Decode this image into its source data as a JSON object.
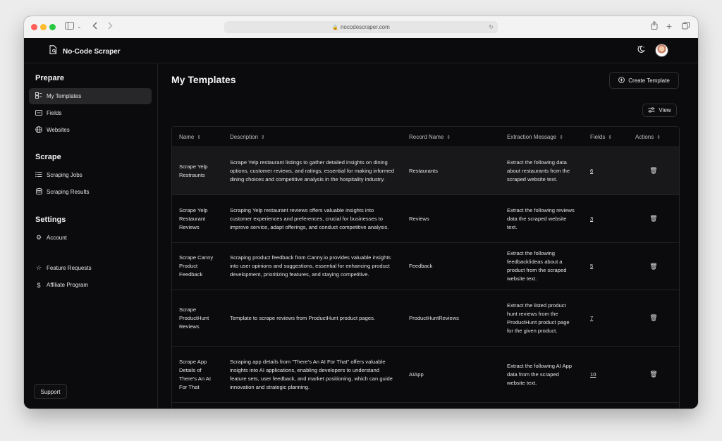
{
  "browser": {
    "url": "nocodescraper.com"
  },
  "app": {
    "name": "No-Code Scraper"
  },
  "sidebar": {
    "sections": [
      {
        "title": "Prepare",
        "items": [
          "My Templates",
          "Fields",
          "Websites"
        ]
      },
      {
        "title": "Scrape",
        "items": [
          "Scraping Jobs",
          "Scraping Results"
        ]
      },
      {
        "title": "Settings",
        "items": [
          "Account"
        ]
      }
    ],
    "extra_items": [
      "Feature Requests",
      "Affiliate Program"
    ],
    "support_label": "Support"
  },
  "main": {
    "title": "My Templates",
    "create_label": "Create Template",
    "view_label": "View"
  },
  "table": {
    "headers": [
      "Name",
      "Description",
      "Record Name",
      "Extraction Message",
      "Fields",
      "Actions"
    ],
    "rows": [
      {
        "name": "Scrape Yelp Restraunts",
        "description": "Scrape Yelp restaurant listings to gather detailed insights on dining options, customer reviews, and ratings, essential for making informed dining choices and competitive analysis in the hospitality industry.",
        "record": "Restaurants",
        "message": "Extract the following data about restaurants from the scraped website text.",
        "fields": "6"
      },
      {
        "name": "Scrape Yelp Restaurant Reviews",
        "description": "Scraping Yelp restaurant reviews offers valuable insights into customer experiences and preferences, crucial for businesses to improve service, adapt offerings, and conduct competitive analysis.",
        "record": "Reviews",
        "message": "Extract the following reviews data the scraped website text.",
        "fields": "3"
      },
      {
        "name": "Scrape Canny Product Feedback",
        "description": "Scraping product feedback from Canny.io provides valuable insights into user opinions and suggestions, essential for enhancing product development, prioritizing features, and staying competitive.",
        "record": "Feedback",
        "message": "Extract the following feedback/ideas about a product from the scraped website text.",
        "fields": "5"
      },
      {
        "name": "Scrape ProductHunt Reviews",
        "description": "Template to scrape reviews from ProductHunt product pages.",
        "record": "ProductHuntReviews",
        "message": "Extract the listed product hunt reviews from the ProductHunt product page for the given product.",
        "fields": "7"
      },
      {
        "name": "Scrape App Details of There's An AI For That",
        "description": "Scraping app details from \"There's An AI For That\" offers valuable insights into AI applications, enabling developers to understand feature sets, user feedback, and market positioning, which can guide innovation and strategic planning.",
        "record": "AIApp",
        "message": "Extract the following AI App data from the scraped website text.",
        "fields": "10"
      }
    ]
  }
}
